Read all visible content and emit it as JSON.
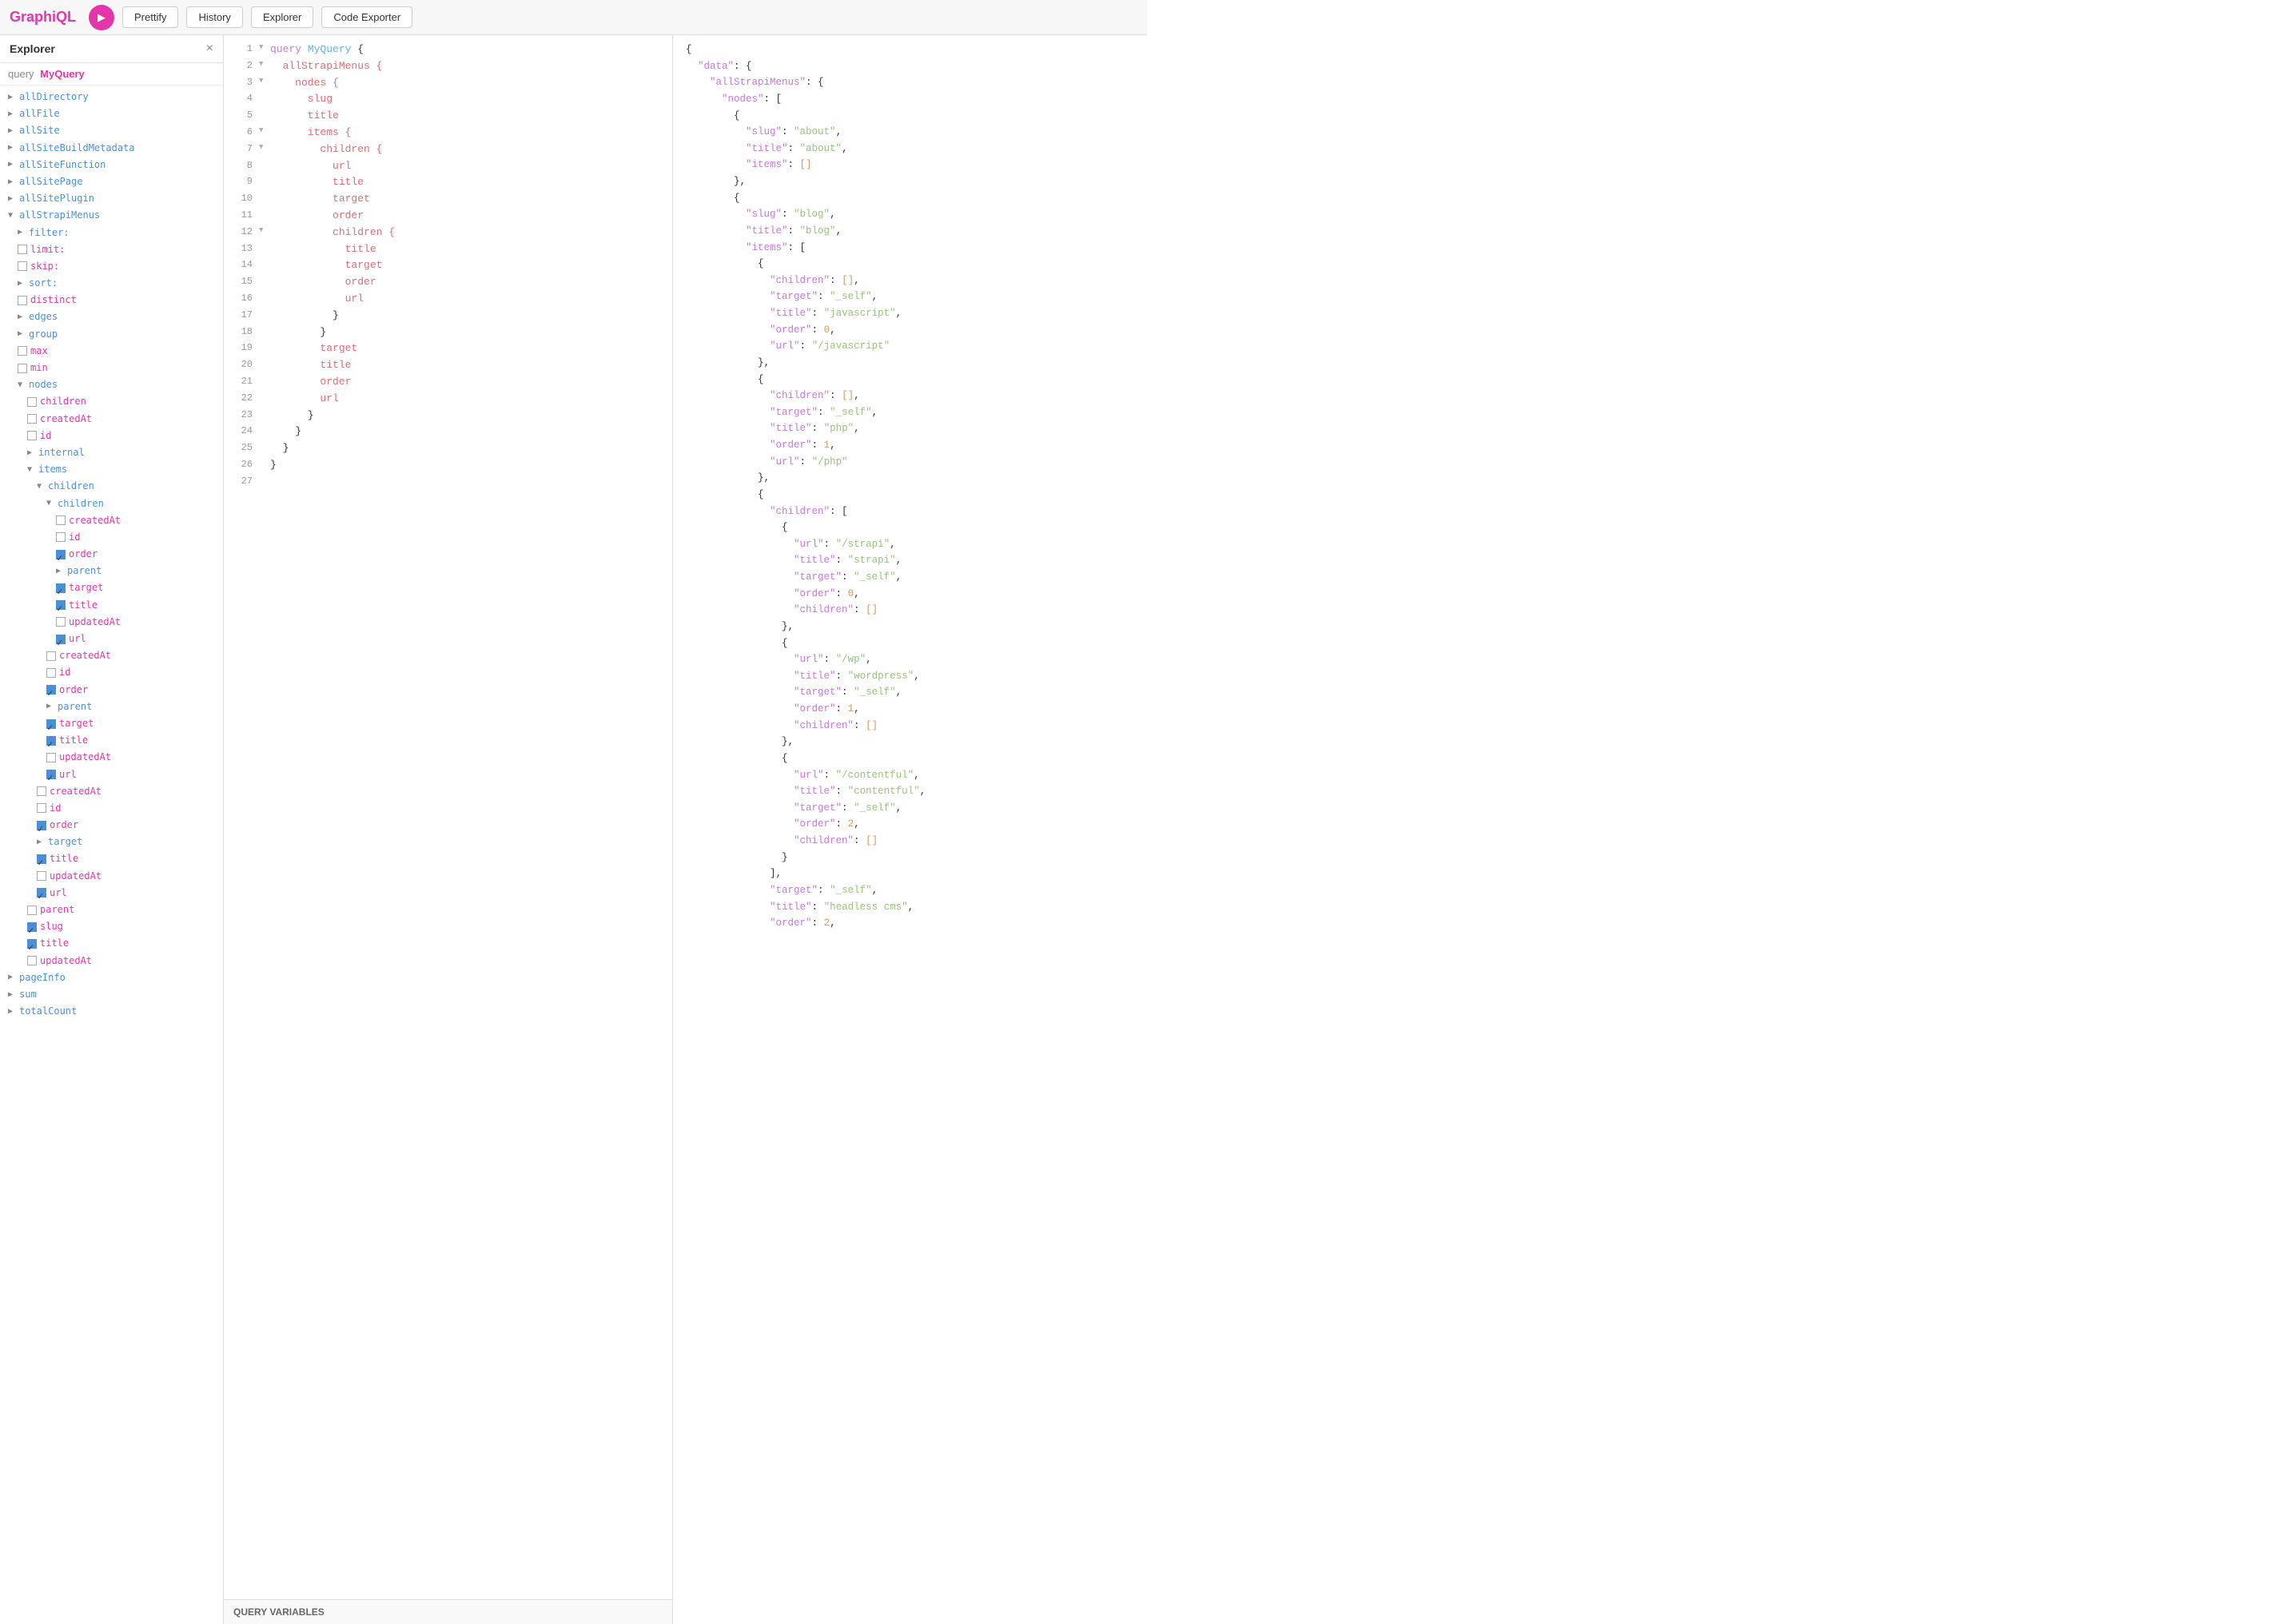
{
  "toolbar": {
    "logo": "GraphiQL",
    "run_label": "▶",
    "prettify_label": "Prettify",
    "history_label": "History",
    "explorer_label": "Explorer",
    "code_exporter_label": "Code Exporter"
  },
  "explorer": {
    "title": "Explorer",
    "close_label": "×",
    "query_prefix": "query",
    "query_name": "MyQuery",
    "items": [
      {
        "indent": 0,
        "type": "arrow",
        "label": "allDirectory",
        "arrow": "▶"
      },
      {
        "indent": 0,
        "type": "arrow",
        "label": "allFile",
        "arrow": "▶"
      },
      {
        "indent": 0,
        "type": "arrow",
        "label": "allSite",
        "arrow": "▶"
      },
      {
        "indent": 0,
        "type": "arrow",
        "label": "allSiteBuildMetadata",
        "arrow": "▶"
      },
      {
        "indent": 0,
        "type": "arrow",
        "label": "allSiteFunction",
        "arrow": "▶"
      },
      {
        "indent": 0,
        "type": "arrow",
        "label": "allSitePage",
        "arrow": "▶"
      },
      {
        "indent": 0,
        "type": "arrow",
        "label": "allSitePlugin",
        "arrow": "▶"
      },
      {
        "indent": 0,
        "type": "expanded",
        "label": "allStrapiMenus",
        "arrow": "▼"
      },
      {
        "indent": 1,
        "type": "arrow",
        "label": "filter:",
        "arrow": "▶"
      },
      {
        "indent": 1,
        "type": "checkbox",
        "label": "limit:",
        "checked": false
      },
      {
        "indent": 1,
        "type": "checkbox",
        "label": "skip:",
        "checked": false
      },
      {
        "indent": 1,
        "type": "arrow",
        "label": "sort:",
        "arrow": "▶"
      },
      {
        "indent": 1,
        "type": "checkbox",
        "label": "distinct",
        "checked": false
      },
      {
        "indent": 1,
        "type": "arrow",
        "label": "edges",
        "arrow": "▶"
      },
      {
        "indent": 1,
        "type": "arrow",
        "label": "group",
        "arrow": "▶"
      },
      {
        "indent": 1,
        "type": "checkbox",
        "label": "max",
        "checked": false
      },
      {
        "indent": 1,
        "type": "checkbox",
        "label": "min",
        "checked": false
      },
      {
        "indent": 1,
        "type": "expanded",
        "label": "nodes",
        "arrow": "▼"
      },
      {
        "indent": 2,
        "type": "checkbox",
        "label": "children",
        "checked": false
      },
      {
        "indent": 2,
        "type": "checkbox",
        "label": "createdAt",
        "checked": false
      },
      {
        "indent": 2,
        "type": "checkbox",
        "label": "id",
        "checked": false
      },
      {
        "indent": 2,
        "type": "arrow",
        "label": "internal",
        "arrow": "▶"
      },
      {
        "indent": 2,
        "type": "expanded",
        "label": "items",
        "arrow": "▼"
      },
      {
        "indent": 3,
        "type": "expanded",
        "label": "children",
        "arrow": "▼"
      },
      {
        "indent": 4,
        "type": "expanded",
        "label": "children",
        "arrow": "▼"
      },
      {
        "indent": 5,
        "type": "checkbox",
        "label": "createdAt",
        "checked": false
      },
      {
        "indent": 5,
        "type": "checkbox",
        "label": "id",
        "checked": false
      },
      {
        "indent": 5,
        "type": "checkbox",
        "label": "order",
        "checked": true
      },
      {
        "indent": 5,
        "type": "arrow",
        "label": "parent",
        "arrow": "▶"
      },
      {
        "indent": 5,
        "type": "checkbox",
        "label": "target",
        "checked": true
      },
      {
        "indent": 5,
        "type": "checkbox",
        "label": "title",
        "checked": true
      },
      {
        "indent": 5,
        "type": "checkbox",
        "label": "updatedAt",
        "checked": false
      },
      {
        "indent": 5,
        "type": "checkbox",
        "label": "url",
        "checked": true
      },
      {
        "indent": 4,
        "type": "checkbox",
        "label": "createdAt",
        "checked": false
      },
      {
        "indent": 4,
        "type": "checkbox",
        "label": "id",
        "checked": false
      },
      {
        "indent": 4,
        "type": "checkbox",
        "label": "order",
        "checked": true
      },
      {
        "indent": 4,
        "type": "arrow",
        "label": "parent",
        "arrow": "▶"
      },
      {
        "indent": 4,
        "type": "checkbox",
        "label": "target",
        "checked": true
      },
      {
        "indent": 4,
        "type": "checkbox",
        "label": "title",
        "checked": true
      },
      {
        "indent": 4,
        "type": "checkbox",
        "label": "updatedAt",
        "checked": false
      },
      {
        "indent": 4,
        "type": "checkbox",
        "label": "url",
        "checked": true
      },
      {
        "indent": 3,
        "type": "checkbox",
        "label": "createdAt",
        "checked": false
      },
      {
        "indent": 3,
        "type": "checkbox",
        "label": "id",
        "checked": false
      },
      {
        "indent": 3,
        "type": "checkbox",
        "label": "order",
        "checked": true
      },
      {
        "indent": 3,
        "type": "arrow",
        "label": "target",
        "checked": true
      },
      {
        "indent": 3,
        "type": "checkbox",
        "label": "title",
        "checked": true
      },
      {
        "indent": 3,
        "type": "checkbox",
        "label": "updatedAt",
        "checked": false
      },
      {
        "indent": 3,
        "type": "checkbox",
        "label": "url",
        "checked": true
      },
      {
        "indent": 2,
        "type": "checkbox",
        "label": "parent",
        "checked": false
      },
      {
        "indent": 2,
        "type": "checkbox",
        "label": "slug",
        "checked": true
      },
      {
        "indent": 2,
        "type": "checkbox",
        "label": "title",
        "checked": true
      },
      {
        "indent": 2,
        "type": "checkbox",
        "label": "updatedAt",
        "checked": false
      },
      {
        "indent": 0,
        "type": "arrow",
        "label": "pageInfo",
        "arrow": "▶"
      },
      {
        "indent": 0,
        "type": "arrow",
        "label": "sum",
        "arrow": "▶"
      },
      {
        "indent": 0,
        "type": "arrow",
        "label": "totalCount",
        "arrow": "▶"
      }
    ]
  },
  "editor": {
    "lines": [
      {
        "num": 1,
        "arrow": "▼",
        "content": "query MyQuery {",
        "parts": [
          {
            "text": "query ",
            "cls": "kw"
          },
          {
            "text": "MyQuery",
            "cls": "fn"
          },
          {
            "text": " {",
            "cls": ""
          }
        ]
      },
      {
        "num": 2,
        "arrow": "▼",
        "content": "  allStrapiMenus {",
        "parts": [
          {
            "text": "  allStrapiMenus {",
            "cls": "field"
          }
        ]
      },
      {
        "num": 3,
        "arrow": "▼",
        "content": "    nodes {",
        "parts": [
          {
            "text": "    nodes {",
            "cls": "field"
          }
        ]
      },
      {
        "num": 4,
        "arrow": " ",
        "content": "      slug",
        "parts": [
          {
            "text": "      slug",
            "cls": "field"
          }
        ]
      },
      {
        "num": 5,
        "arrow": " ",
        "content": "      title",
        "parts": [
          {
            "text": "      title",
            "cls": "field"
          }
        ]
      },
      {
        "num": 6,
        "arrow": "▼",
        "content": "      items {",
        "parts": [
          {
            "text": "      items {",
            "cls": "field"
          }
        ]
      },
      {
        "num": 7,
        "arrow": "▼",
        "content": "        children {",
        "parts": [
          {
            "text": "        children {",
            "cls": "field"
          }
        ]
      },
      {
        "num": 8,
        "arrow": " ",
        "content": "          url",
        "parts": [
          {
            "text": "          url",
            "cls": "field"
          }
        ]
      },
      {
        "num": 9,
        "arrow": " ",
        "content": "          title",
        "parts": [
          {
            "text": "          title",
            "cls": "field"
          }
        ]
      },
      {
        "num": 10,
        "arrow": " ",
        "content": "          target",
        "parts": [
          {
            "text": "          target",
            "cls": "field"
          }
        ]
      },
      {
        "num": 11,
        "arrow": " ",
        "content": "          order",
        "parts": [
          {
            "text": "          order",
            "cls": "field"
          }
        ]
      },
      {
        "num": 12,
        "arrow": "▼",
        "content": "          children {",
        "parts": [
          {
            "text": "          children {",
            "cls": "field"
          }
        ]
      },
      {
        "num": 13,
        "arrow": " ",
        "content": "            title",
        "parts": [
          {
            "text": "            title",
            "cls": "field"
          }
        ]
      },
      {
        "num": 14,
        "arrow": " ",
        "content": "            target",
        "parts": [
          {
            "text": "            target",
            "cls": "field"
          }
        ]
      },
      {
        "num": 15,
        "arrow": " ",
        "content": "            order",
        "parts": [
          {
            "text": "            order",
            "cls": "field"
          }
        ]
      },
      {
        "num": 16,
        "arrow": " ",
        "content": "            url",
        "parts": [
          {
            "text": "            url",
            "cls": "field"
          }
        ]
      },
      {
        "num": 17,
        "arrow": " ",
        "content": "          }",
        "parts": [
          {
            "text": "          }",
            "cls": ""
          }
        ]
      },
      {
        "num": 18,
        "arrow": " ",
        "content": "        }",
        "parts": [
          {
            "text": "        }",
            "cls": ""
          }
        ]
      },
      {
        "num": 19,
        "arrow": " ",
        "content": "        target",
        "parts": [
          {
            "text": "        target",
            "cls": "field"
          }
        ]
      },
      {
        "num": 20,
        "arrow": " ",
        "content": "        title",
        "parts": [
          {
            "text": "        title",
            "cls": "field"
          }
        ]
      },
      {
        "num": 21,
        "arrow": " ",
        "content": "        order",
        "parts": [
          {
            "text": "        order",
            "cls": "field"
          }
        ]
      },
      {
        "num": 22,
        "arrow": " ",
        "content": "        url",
        "parts": [
          {
            "text": "        url",
            "cls": "field"
          }
        ]
      },
      {
        "num": 23,
        "arrow": " ",
        "content": "      }",
        "parts": [
          {
            "text": "      }",
            "cls": ""
          }
        ]
      },
      {
        "num": 24,
        "arrow": " ",
        "content": "    }",
        "parts": [
          {
            "text": "    }",
            "cls": ""
          }
        ]
      },
      {
        "num": 25,
        "arrow": " ",
        "content": "  }",
        "parts": [
          {
            "text": "  }",
            "cls": ""
          }
        ]
      },
      {
        "num": 26,
        "arrow": " ",
        "content": "}",
        "parts": [
          {
            "text": "}",
            "cls": ""
          }
        ]
      },
      {
        "num": 27,
        "arrow": " ",
        "content": "",
        "parts": []
      }
    ],
    "query_vars_label": "QUERY VARIABLES"
  },
  "result": {
    "content": "{\n  \"data\": {\n    \"allStrapiMenus\": {\n      \"nodes\": [\n        {\n          \"slug\": \"about\",\n          \"title\": \"about\",\n          \"items\": []\n        },\n        {\n          \"slug\": \"blog\",\n          \"title\": \"blog\",\n          \"items\": [\n            {\n              \"children\": [],\n              \"target\": \"_self\",\n              \"title\": \"javascript\",\n              \"order\": 0,\n              \"url\": \"/javascript\"\n            },\n            {\n              \"children\": [],\n              \"target\": \"_self\",\n              \"title\": \"php\",\n              \"order\": 1,\n              \"url\": \"/php\"\n            },\n            {\n              \"children\": [\n                {\n                  \"url\": \"/strapi\",\n                  \"title\": \"strapi\",\n                  \"target\": \"_self\",\n                  \"order\": 0,\n                  \"children\": []\n                },\n                {\n                  \"url\": \"/wp\",\n                  \"title\": \"wordpress\",\n                  \"target\": \"_self\",\n                  \"order\": 1,\n                  \"children\": []\n                },\n                {\n                  \"url\": \"/contentful\",\n                  \"title\": \"contentful\",\n                  \"target\": \"_self\",\n                  \"order\": 2,\n                  \"children\": []\n                }\n              ],\n              \"target\": \"_self\",\n              \"title\": \"headless cms\",\n              \"order\": 2,"
  }
}
